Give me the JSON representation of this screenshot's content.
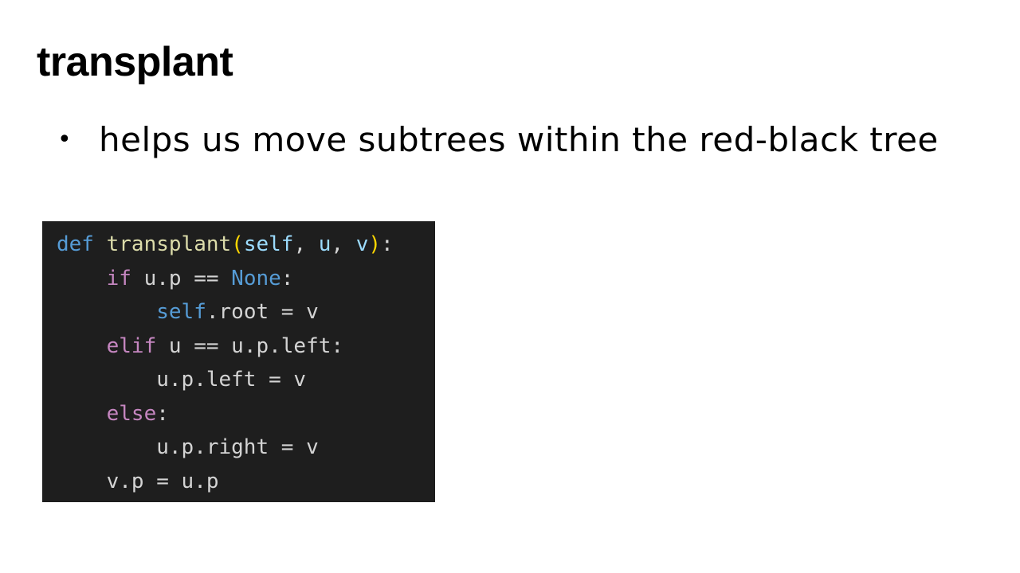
{
  "slide": {
    "title": "transplant",
    "bullet_symbol": "•",
    "bullet_text": "helps us move subtrees within the red-black tree"
  },
  "code": {
    "language": "python",
    "colors": {
      "background": "#1e1e1e",
      "keyword": "#569cd6",
      "control": "#c586c0",
      "function": "#dcdcaa",
      "bracket": "#ffd700",
      "parameter": "#9cdcfe",
      "text": "#d4d4d4"
    },
    "lines": [
      {
        "indent": "",
        "tokens": [
          {
            "text": "def",
            "cls": "kw-def"
          },
          {
            "text": " ",
            "cls": "plain"
          },
          {
            "text": "transplant",
            "cls": "fn"
          },
          {
            "text": "(",
            "cls": "paren"
          },
          {
            "text": "self",
            "cls": "param"
          },
          {
            "text": ", ",
            "cls": "plain"
          },
          {
            "text": "u",
            "cls": "param"
          },
          {
            "text": ", ",
            "cls": "plain"
          },
          {
            "text": "v",
            "cls": "param"
          },
          {
            "text": ")",
            "cls": "paren"
          },
          {
            "text": ":",
            "cls": "plain"
          }
        ]
      },
      {
        "indent": "    ",
        "tokens": [
          {
            "text": "if",
            "cls": "kw-ctrl"
          },
          {
            "text": " u.p == ",
            "cls": "plain"
          },
          {
            "text": "None",
            "cls": "const"
          },
          {
            "text": ":",
            "cls": "plain"
          }
        ]
      },
      {
        "indent": "        ",
        "tokens": [
          {
            "text": "self",
            "cls": "selfkw"
          },
          {
            "text": ".root = v",
            "cls": "plain"
          }
        ]
      },
      {
        "indent": "    ",
        "tokens": [
          {
            "text": "elif",
            "cls": "kw-ctrl"
          },
          {
            "text": " u == u.p.left:",
            "cls": "plain"
          }
        ]
      },
      {
        "indent": "        ",
        "tokens": [
          {
            "text": "u.p.left = v",
            "cls": "plain"
          }
        ]
      },
      {
        "indent": "    ",
        "tokens": [
          {
            "text": "else",
            "cls": "kw-ctrl"
          },
          {
            "text": ":",
            "cls": "plain"
          }
        ]
      },
      {
        "indent": "        ",
        "tokens": [
          {
            "text": "u.p.right = v",
            "cls": "plain"
          }
        ]
      },
      {
        "indent": "    ",
        "tokens": [
          {
            "text": "v.p = u.p",
            "cls": "plain"
          }
        ]
      }
    ]
  }
}
